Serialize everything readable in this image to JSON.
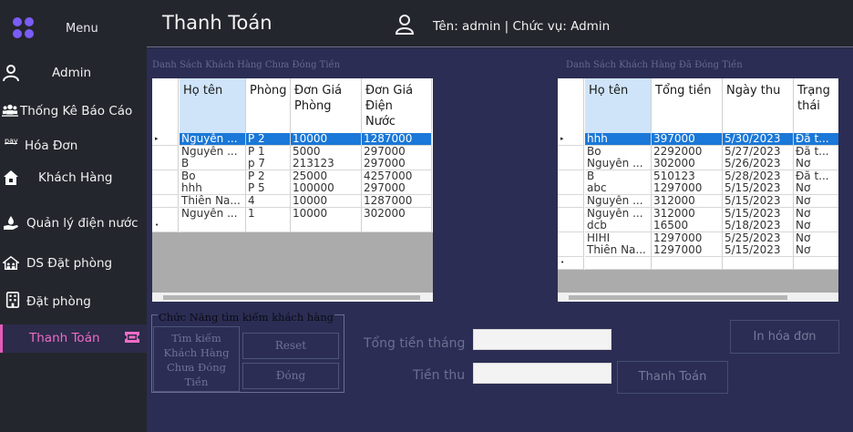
{
  "sidebar": {
    "menu_label": "Menu",
    "items": [
      {
        "label": "Admin",
        "icon": "user-icon"
      },
      {
        "label": "Thống Kê Báo Cáo",
        "icon": "users-group-icon"
      },
      {
        "label": "Hóa Đơn",
        "icon": "pay-icon"
      },
      {
        "label": "Khách Hàng",
        "icon": "home-icon"
      },
      {
        "label": "Quản lý điện nước",
        "icon": "hand-water-icon"
      },
      {
        "label": "DS Đặt phòng",
        "icon": "house-people-icon"
      },
      {
        "label": "Đặt phòng",
        "icon": "building-icon"
      },
      {
        "label": "Thanh Toán",
        "icon": "ticket-icon"
      }
    ],
    "active_index": 7,
    "accent": "#e65ab8",
    "logo_color": "#7b5cf5"
  },
  "header": {
    "title": "Thanh Toán",
    "user_info": "Tên: admin | Chức vụ: Admin"
  },
  "unpaid": {
    "caption": "Danh Sách Khách Hàng Chưa Đóng Tiền",
    "columns": [
      "Họ tên",
      "Phòng",
      "Đơn Giá\nPhòng",
      "Đơn Giá\nĐiện\nNước"
    ],
    "rows": [
      [
        "Nguyễn ...",
        "P 2",
        "10000",
        "1287000"
      ],
      [
        "Nguyễn ...",
        "P 1",
        "5000",
        "297000"
      ],
      [
        "B",
        "p 7",
        "213123",
        "297000"
      ],
      [
        "Bo",
        "P 2",
        "25000",
        "4257000"
      ],
      [
        "hhh",
        "P 5",
        "100000",
        "297000"
      ],
      [
        "Thiên Na...",
        "4",
        "10000",
        "1287000"
      ],
      [
        "Nguyễn ...",
        "1",
        "10000",
        "302000"
      ]
    ]
  },
  "paid": {
    "caption": "Danh Sách Khách Hàng Đã Đóng Tiền",
    "columns": [
      "Họ tên",
      "Tổng tiền",
      "Ngày thu",
      "Trạng\nthái"
    ],
    "rows": [
      [
        "hhh",
        "397000",
        "5/30/2023",
        "Đã t..."
      ],
      [
        "Bo",
        "2292000",
        "5/27/2023",
        "Đã t..."
      ],
      [
        "Nguyễn ...",
        "302000",
        "5/26/2023",
        "Nơ"
      ],
      [
        "B",
        "510123",
        "5/28/2023",
        "Đã t..."
      ],
      [
        "abc",
        "1297000",
        "5/15/2023",
        "Nơ"
      ],
      [
        "Nguyễn ...",
        "312000",
        "5/15/2023",
        "Nơ"
      ],
      [
        "Nguyễn ...",
        "312000",
        "5/15/2023",
        "Nơ"
      ],
      [
        "dcb",
        "16500",
        "5/18/2023",
        "Nơ"
      ],
      [
        "HIHI",
        "1297000",
        "5/25/2023",
        "Nơ"
      ],
      [
        "Thiên Na...",
        "1297000",
        "5/15/2023",
        "Nơ"
      ]
    ]
  },
  "search": {
    "group_title": "Chức Năng tìm kiếm khách hàng",
    "search_button": "Tìm kiếm\nKhách Hàng\nChưa Đóng\nTiền",
    "reset_button": "Reset",
    "close_button": "Đóng"
  },
  "payment": {
    "monthly_total_label": "Tổng tiền tháng",
    "monthly_total_value": "",
    "amount_label": "Tiền thu",
    "amount_value": "",
    "pay_button": "Thanh Toán",
    "print_button": "In hóa đơn"
  },
  "colors": {
    "selected_row": "#1a78d8",
    "selected_header": "#cfe4f8",
    "main_bg": "#2b2d54"
  }
}
